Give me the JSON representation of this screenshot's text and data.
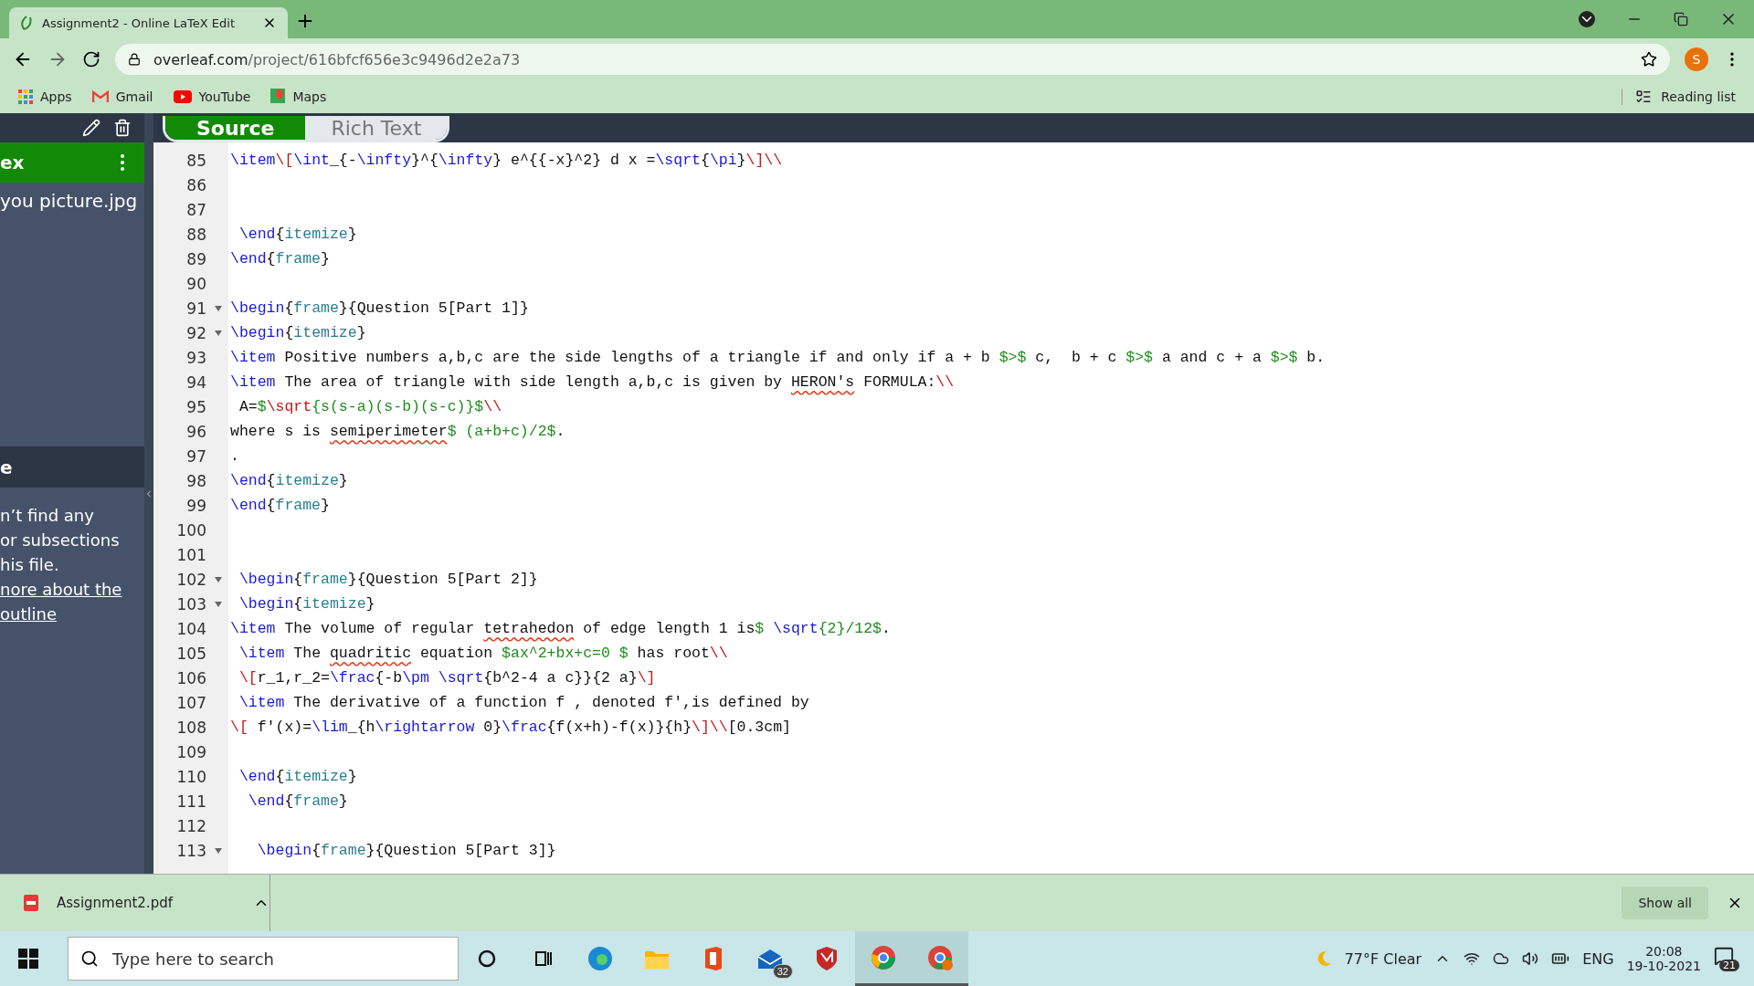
{
  "browser": {
    "tab_title": "Assignment2 - Online LaTeX Edit",
    "url_host": "overleaf.com",
    "url_path": "/project/616bfcf656e3c9496d2e2a73",
    "profile_initial": "S",
    "bookmarks": [
      {
        "kind": "apps",
        "label": "Apps"
      },
      {
        "kind": "gmail",
        "label": "Gmail"
      },
      {
        "kind": "youtube",
        "label": "YouTube"
      },
      {
        "kind": "maps",
        "label": "Maps"
      }
    ],
    "reading_list": "Reading list"
  },
  "toggle": [
    {
      "label": "Source",
      "selected": true
    },
    {
      "label": "Rich Text",
      "selected": false
    }
  ],
  "sidebar": {
    "file_item": "ex",
    "file_name": "you picture.jpg",
    "outline_header": "e",
    "outline_message": [
      {
        "kind": "text",
        "text": "n’t find any"
      },
      {
        "kind": "text",
        "text": "or subsections"
      },
      {
        "kind": "text",
        "text": "his file."
      },
      {
        "kind": "link",
        "text": "nore about the"
      },
      {
        "kind": "link",
        "text": "outline"
      }
    ]
  },
  "lines": [
    {
      "number": "85",
      "foldable": false,
      "segments": [
        {
          "kind": "cmd",
          "text": "\\item"
        },
        {
          "kind": "red",
          "text": "\\["
        },
        {
          "kind": "cmd",
          "text": "\\int"
        },
        {
          "kind": "plain",
          "text": "_{-"
        },
        {
          "kind": "cmd",
          "text": "\\infty"
        },
        {
          "kind": "plain",
          "text": "}^{"
        },
        {
          "kind": "cmd",
          "text": "\\infty"
        },
        {
          "kind": "plain",
          "text": "} e^{{-x}^2} d x ="
        },
        {
          "kind": "cmd",
          "text": "\\sqrt"
        },
        {
          "kind": "plain",
          "text": "{"
        },
        {
          "kind": "cmd",
          "text": "\\pi"
        },
        {
          "kind": "plain",
          "text": "}"
        },
        {
          "kind": "red",
          "text": "\\]\\\\"
        }
      ]
    },
    {
      "number": "86",
      "foldable": false
    },
    {
      "number": "87",
      "foldable": false
    },
    {
      "number": "88",
      "foldable": false,
      "segments": [
        {
          "kind": "cmd",
          "text": " \\end"
        },
        {
          "kind": "plain",
          "text": "{"
        },
        {
          "kind": "arg",
          "text": "itemize"
        },
        {
          "kind": "plain",
          "text": "}"
        }
      ]
    },
    {
      "number": "89",
      "foldable": false,
      "segments": [
        {
          "kind": "cmd",
          "text": "\\end"
        },
        {
          "kind": "plain",
          "text": "{"
        },
        {
          "kind": "arg",
          "text": "frame"
        },
        {
          "kind": "plain",
          "text": "}"
        }
      ]
    },
    {
      "number": "90",
      "foldable": false
    },
    {
      "number": "91",
      "foldable": true,
      "segments": [
        {
          "kind": "cmd",
          "text": "\\begin"
        },
        {
          "kind": "plain",
          "text": "{"
        },
        {
          "kind": "arg",
          "text": "frame"
        },
        {
          "kind": "plain",
          "text": "}{Question 5[Part 1]}"
        }
      ]
    },
    {
      "number": "92",
      "foldable": true,
      "segments": [
        {
          "kind": "cmd",
          "text": "\\begin"
        },
        {
          "kind": "plain",
          "text": "{"
        },
        {
          "kind": "arg",
          "text": "itemize"
        },
        {
          "kind": "plain",
          "text": "}"
        }
      ]
    },
    {
      "number": "93",
      "foldable": false,
      "segments": [
        {
          "kind": "cmd",
          "text": "\\item"
        },
        {
          "kind": "plain",
          "text": " Positive numbers a,b,c are the side lengths of a triangle if and only if a + b "
        },
        {
          "kind": "math",
          "text": "$>$"
        },
        {
          "kind": "plain",
          "text": " c,  b + c "
        },
        {
          "kind": "math",
          "text": "$>$"
        },
        {
          "kind": "plain",
          "text": " a and c + a "
        },
        {
          "kind": "math",
          "text": "$>$"
        },
        {
          "kind": "plain",
          "text": " b."
        }
      ]
    },
    {
      "number": "94",
      "foldable": false,
      "segments": [
        {
          "kind": "cmd",
          "text": "\\item"
        },
        {
          "kind": "plain",
          "text": " The area of triangle with side length a,b,c is given by "
        },
        {
          "kind": "misspelled",
          "text": "HERON's"
        },
        {
          "kind": "plain",
          "text": " FORMULA:"
        },
        {
          "kind": "red",
          "text": "\\\\"
        }
      ]
    },
    {
      "number": "95",
      "foldable": false,
      "segments": [
        {
          "kind": "plain",
          "text": " A="
        },
        {
          "kind": "math",
          "text": "$"
        },
        {
          "kind": "red",
          "text": "\\sqrt"
        },
        {
          "kind": "math",
          "text": "{s(s-a)(s-b)(s-c)}$"
        },
        {
          "kind": "red",
          "text": "\\\\"
        }
      ]
    },
    {
      "number": "96",
      "foldable": false,
      "segments": [
        {
          "kind": "plain",
          "text": "where s is "
        },
        {
          "kind": "misspelled",
          "text": "semiperimeter"
        },
        {
          "kind": "math",
          "text": "$ (a+b+c)/2$"
        },
        {
          "kind": "plain",
          "text": "."
        }
      ]
    },
    {
      "number": "97",
      "foldable": false,
      "segments": [
        {
          "kind": "plain",
          "text": "."
        }
      ]
    },
    {
      "number": "98",
      "foldable": false,
      "segments": [
        {
          "kind": "cmd",
          "text": "\\end"
        },
        {
          "kind": "plain",
          "text": "{"
        },
        {
          "kind": "arg",
          "text": "itemize"
        },
        {
          "kind": "plain",
          "text": "}"
        }
      ]
    },
    {
      "number": "99",
      "foldable": false,
      "segments": [
        {
          "kind": "cmd",
          "text": "\\end"
        },
        {
          "kind": "plain",
          "text": "{"
        },
        {
          "kind": "arg",
          "text": "frame"
        },
        {
          "kind": "plain",
          "text": "}"
        }
      ]
    },
    {
      "number": "100",
      "foldable": false
    },
    {
      "number": "101",
      "foldable": false
    },
    {
      "number": "102",
      "foldable": true,
      "segments": [
        {
          "kind": "cmd",
          "text": " \\begin"
        },
        {
          "kind": "plain",
          "text": "{"
        },
        {
          "kind": "arg",
          "text": "frame"
        },
        {
          "kind": "plain",
          "text": "}{Question 5[Part 2]}"
        }
      ]
    },
    {
      "number": "103",
      "foldable": true,
      "segments": [
        {
          "kind": "cmd",
          "text": " \\begin"
        },
        {
          "kind": "plain",
          "text": "{"
        },
        {
          "kind": "arg",
          "text": "itemize"
        },
        {
          "kind": "plain",
          "text": "}"
        }
      ]
    },
    {
      "number": "104",
      "foldable": false,
      "segments": [
        {
          "kind": "cmd",
          "text": "\\item"
        },
        {
          "kind": "plain",
          "text": " The volume of regular "
        },
        {
          "kind": "misspelled",
          "text": "tetrahedon"
        },
        {
          "kind": "plain",
          "text": " of edge length 1 is"
        },
        {
          "kind": "math",
          "text": "$ "
        },
        {
          "kind": "cmd",
          "text": "\\sqrt"
        },
        {
          "kind": "math",
          "text": "{2}/12$"
        },
        {
          "kind": "plain",
          "text": "."
        }
      ]
    },
    {
      "number": "105",
      "foldable": false,
      "segments": [
        {
          "kind": "cmd",
          "text": " \\item"
        },
        {
          "kind": "plain",
          "text": " The "
        },
        {
          "kind": "misspelled",
          "text": "quadritic"
        },
        {
          "kind": "plain",
          "text": " equation "
        },
        {
          "kind": "math",
          "text": "$ax^2+bx+c=0 $"
        },
        {
          "kind": "plain",
          "text": " has root"
        },
        {
          "kind": "red",
          "text": "\\\\"
        }
      ]
    },
    {
      "number": "106",
      "foldable": false,
      "segments": [
        {
          "kind": "red",
          "text": " \\["
        },
        {
          "kind": "plain",
          "text": "r_1,r_2="
        },
        {
          "kind": "cmd",
          "text": "\\frac"
        },
        {
          "kind": "plain",
          "text": "{-b"
        },
        {
          "kind": "cmd",
          "text": "\\pm"
        },
        {
          "kind": "cmd",
          "text": " \\sqrt"
        },
        {
          "kind": "plain",
          "text": "{b^2-4 a c}}{2 a}"
        },
        {
          "kind": "red",
          "text": "\\]"
        }
      ]
    },
    {
      "number": "107",
      "foldable": false,
      "segments": [
        {
          "kind": "cmd",
          "text": " \\item"
        },
        {
          "kind": "plain",
          "text": " The derivative of a function f , denoted f',is defined by"
        }
      ]
    },
    {
      "number": "108",
      "foldable": false,
      "segments": [
        {
          "kind": "red",
          "text": "\\["
        },
        {
          "kind": "plain",
          "text": " f'(x)="
        },
        {
          "kind": "cmd",
          "text": "\\lim"
        },
        {
          "kind": "plain",
          "text": "_{h"
        },
        {
          "kind": "cmd",
          "text": "\\rightarrow"
        },
        {
          "kind": "plain",
          "text": " 0}"
        },
        {
          "kind": "cmd",
          "text": "\\frac"
        },
        {
          "kind": "plain",
          "text": "{f(x+h)-f(x)}{h}"
        },
        {
          "kind": "red",
          "text": "\\]\\\\"
        },
        {
          "kind": "plain",
          "text": "[0.3cm]"
        }
      ]
    },
    {
      "number": "109",
      "foldable": false
    },
    {
      "number": "110",
      "foldable": false,
      "segments": [
        {
          "kind": "cmd",
          "text": " \\end"
        },
        {
          "kind": "plain",
          "text": "{"
        },
        {
          "kind": "arg",
          "text": "itemize"
        },
        {
          "kind": "plain",
          "text": "}"
        }
      ]
    },
    {
      "number": "111",
      "foldable": false,
      "segments": [
        {
          "kind": "cmd",
          "text": "  \\end"
        },
        {
          "kind": "plain",
          "text": "{"
        },
        {
          "kind": "arg",
          "text": "frame"
        },
        {
          "kind": "plain",
          "text": "}"
        }
      ]
    },
    {
      "number": "112",
      "foldable": false
    },
    {
      "number": "113",
      "foldable": true,
      "segments": [
        {
          "kind": "cmd",
          "text": "   \\begin"
        },
        {
          "kind": "plain",
          "text": "{"
        },
        {
          "kind": "arg",
          "text": "frame"
        },
        {
          "kind": "plain",
          "text": "}{Question 5[Part 3]}"
        }
      ]
    }
  ],
  "download": {
    "file": "Assignment2.pdf",
    "show_all": "Show all"
  },
  "taskbar": {
    "search_placeholder": "Type here to search",
    "mail_badge": "32",
    "weather": "77°F  Clear",
    "language": "ENG",
    "time": "20:08",
    "date": "19-10-2021",
    "notifications": "21"
  }
}
